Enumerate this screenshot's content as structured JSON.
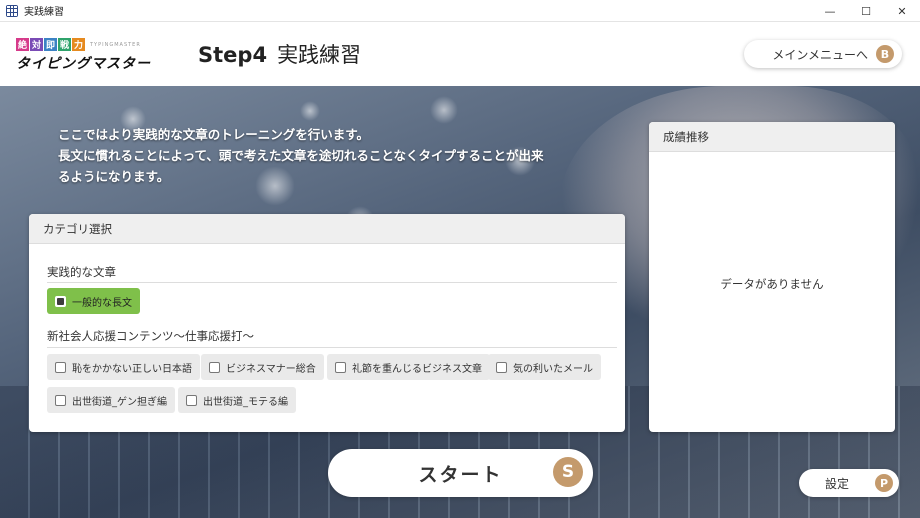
{
  "window": {
    "title": "実践練習",
    "controls": {
      "minimize": "—",
      "maximize": "☐",
      "close": "✕"
    }
  },
  "logo": {
    "chars": [
      "絶",
      "対",
      "即",
      "戦",
      "力"
    ],
    "char_colors": [
      "#d63a8a",
      "#7a4bb5",
      "#3b82c4",
      "#2fa36b",
      "#e68a1f"
    ],
    "subtitle": "TYPINGMASTER",
    "main": "タイピングマスター"
  },
  "header": {
    "step": "Step4",
    "title": "実践練習",
    "menu_button": {
      "label": "メインメニューへ",
      "badge": "B"
    }
  },
  "intro": {
    "lines": [
      "ここではより実践的な文章のトレーニングを行います。",
      "長文に慣れることによって、頭で考えた文章を途切れることなくタイプすることが出来",
      "るようになります。"
    ]
  },
  "category_panel": {
    "title": "カテゴリ選択",
    "section1": {
      "label": "実践的な文章",
      "items": [
        {
          "label": "一般的な長文",
          "checked": true
        }
      ]
    },
    "section2": {
      "label": "新社会人応援コンテンツ〜仕事応援打〜",
      "items": [
        {
          "label": "恥をかかない正しい日本語",
          "checked": false
        },
        {
          "label": "ビジネスマナー総合",
          "checked": false
        },
        {
          "label": "礼節を重んじるビジネス文章",
          "checked": false
        },
        {
          "label": "気の利いたメール",
          "checked": false
        },
        {
          "label": "出世街道_ゲン担ぎ編",
          "checked": false
        },
        {
          "label": "出世街道_モテる編",
          "checked": false
        }
      ]
    }
  },
  "grade_panel": {
    "title": "成績推移",
    "empty_message": "データがありません"
  },
  "start_button": {
    "label": "スタート",
    "badge": "S"
  },
  "settings_button": {
    "label": "設定",
    "badge": "P"
  },
  "colors": {
    "accent_green": "#7fc04a",
    "badge_tan": "#c49a6c"
  }
}
